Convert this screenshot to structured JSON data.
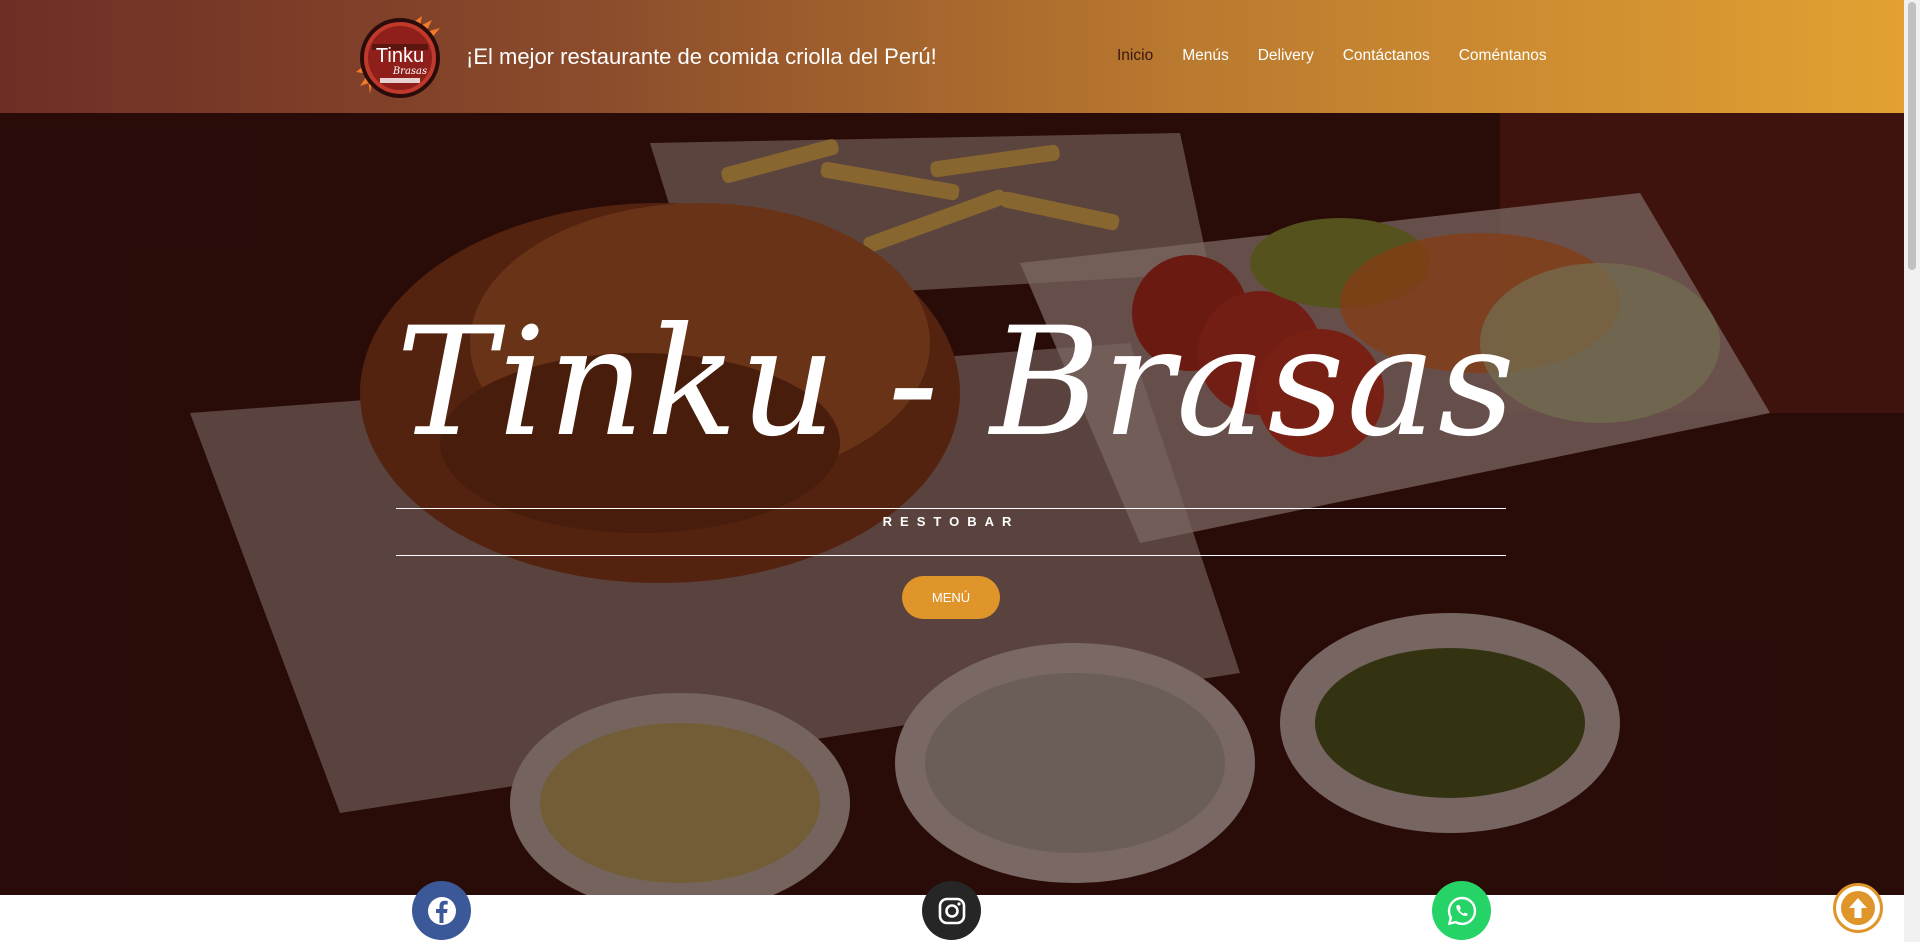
{
  "header": {
    "logo": {
      "text": "Tinku",
      "subtext": "Brasas",
      "icon": "tinku-brasas-logo"
    },
    "tagline": "¡El mejor restaurante de comida criolla del Perú!",
    "nav": [
      {
        "label": "Inicio",
        "active": true
      },
      {
        "label": "Menús",
        "active": false
      },
      {
        "label": "Delivery",
        "active": false
      },
      {
        "label": "Contáctanos",
        "active": false
      },
      {
        "label": "Coméntanos",
        "active": false
      }
    ]
  },
  "hero": {
    "title": "Tinku - Brasas",
    "subtitle": "RESTOBAR",
    "cta_label": "MENÚ",
    "background_icon": "roast-chicken-photo"
  },
  "social": [
    {
      "name": "facebook",
      "icon": "facebook-icon",
      "color": "#3b5998"
    },
    {
      "name": "instagram",
      "icon": "instagram-icon",
      "color": "#262626"
    },
    {
      "name": "whatsapp",
      "icon": "whatsapp-icon",
      "color": "#25d366"
    }
  ],
  "colors": {
    "accent": "#e0952a",
    "header_start": "#6e2e25",
    "header_end": "#e3a132",
    "active_nav": "#3a1710"
  }
}
